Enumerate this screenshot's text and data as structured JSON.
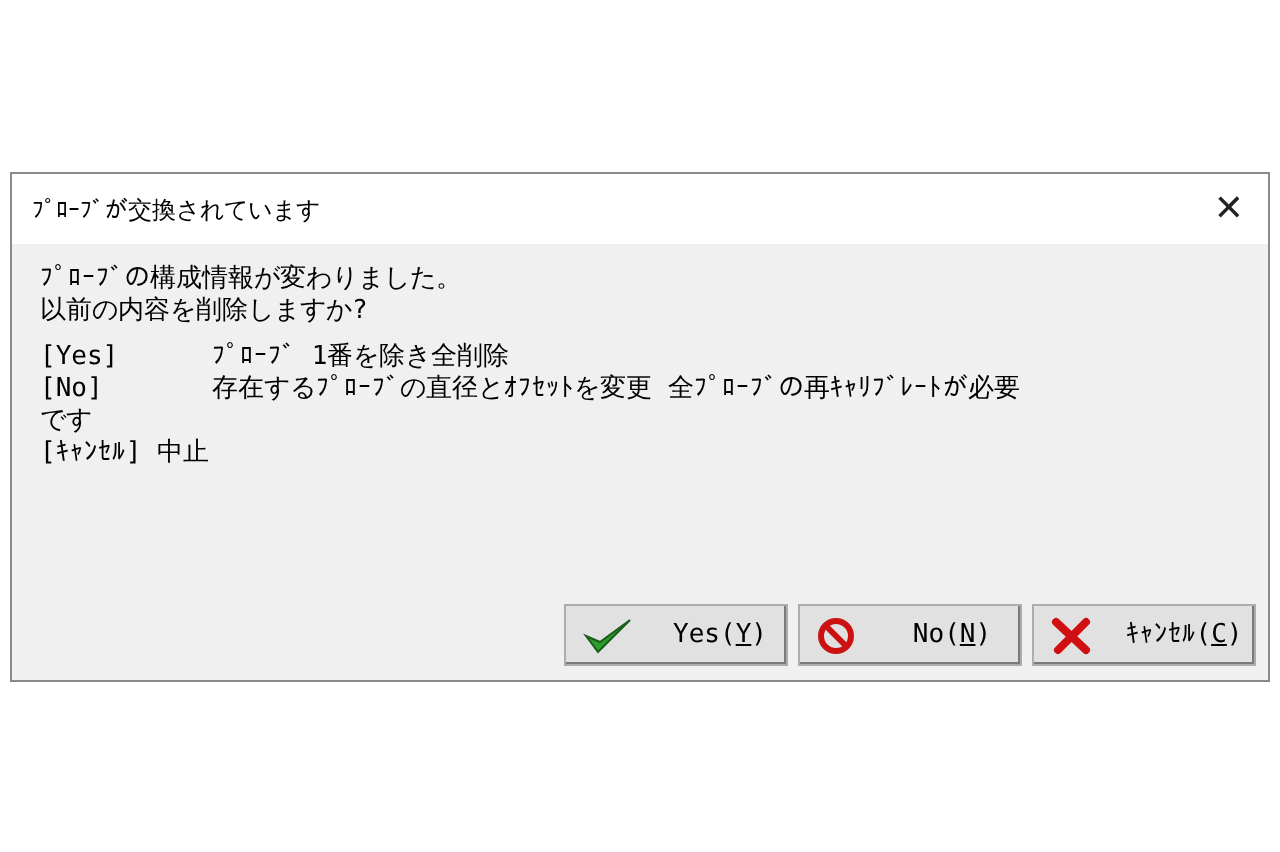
{
  "window": {
    "title": "ﾌﾟﾛｰﾌﾞが交換されています",
    "close": "✕"
  },
  "message": [
    "ﾌﾟﾛｰﾌﾞの構成情報が変わりました。",
    "以前の内容を削除しますか?"
  ],
  "options": [
    "[Yes]      ﾌﾟﾛｰﾌﾞ 1番を除き全削除",
    "[No]       存在するﾌﾟﾛｰﾌﾞの直径とｵﾌｾｯﾄを変更 全ﾌﾟﾛｰﾌﾞの再ｷｬﾘﾌﾞﾚｰﾄが必要",
    "です",
    "[ｷｬﾝｾﾙ] 中止"
  ],
  "buttons": [
    {
      "kind": "yes",
      "prefix": "Yes(",
      "mnemonic": "Y",
      "suffix": ")"
    },
    {
      "kind": "no",
      "prefix": "No(",
      "mnemonic": "N",
      "suffix": ")"
    },
    {
      "kind": "cancel",
      "prefix": "ｷｬﾝｾﾙ(",
      "mnemonic": "C",
      "suffix": ")"
    }
  ]
}
